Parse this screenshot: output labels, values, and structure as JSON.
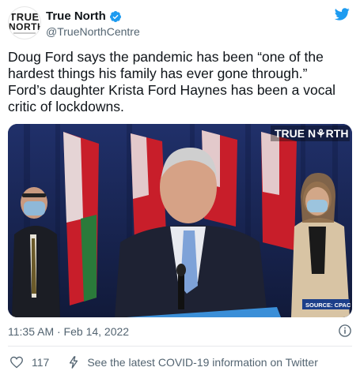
{
  "account": {
    "avatar_line1": "TRUE",
    "avatar_line2": "NORTH",
    "name": "True North",
    "handle": "@TrueNorthCentre"
  },
  "tweet": {
    "line1": "Doug Ford says the pandemic has been “one of the",
    "line2": "hardest things his family has ever gone through.”",
    "line3": "Ford’s daughter Krista Ford Haynes has been a vocal",
    "line4": "critic of lockdowns."
  },
  "video": {
    "watermark": "TRUE N⚘RTH",
    "source": "SOURCE: CPAC"
  },
  "meta": {
    "timestamp": "11:35 AM · Feb 14, 2022"
  },
  "actions": {
    "likes": "117",
    "covid_link": "See the latest COVID-19 information on Twitter"
  },
  "colors": {
    "twitter_blue": "#1d9bf0",
    "text_primary": "#0f1419",
    "text_secondary": "#536471"
  },
  "icons": [
    "verified-icon",
    "twitter-bird-icon",
    "info-icon",
    "heart-icon",
    "lightning-icon"
  ]
}
